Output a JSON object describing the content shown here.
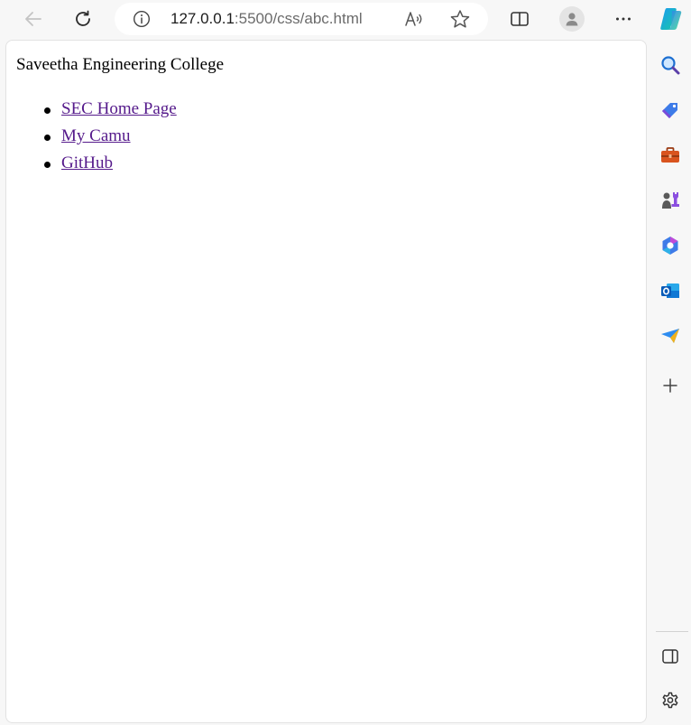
{
  "toolbar": {
    "back_icon": "back-arrow-icon",
    "refresh_icon": "refresh-icon",
    "address": {
      "host": "127.0.0.1",
      "rest": ":5500/css/abc.html",
      "info_icon": "info-icon"
    },
    "read_aloud_icon": "read-aloud-icon",
    "favorite_icon": "star-icon",
    "split_screen_icon": "split-screen-icon",
    "profile_icon": "profile-icon",
    "more_icon": "more-dots-icon",
    "copilot_icon": "copilot-icon"
  },
  "page": {
    "heading": "Saveetha Engineering College",
    "links": [
      {
        "label": "SEC Home Page"
      },
      {
        "label": "My Camu"
      },
      {
        "label": "GitHub"
      }
    ]
  },
  "sidebar": {
    "items": [
      "search-icon",
      "shopping-tag-icon",
      "tools-briefcase-icon",
      "games-icon",
      "microsoft365-icon",
      "outlook-icon",
      "drop-send-icon",
      "add-icon"
    ],
    "bottom": [
      "sidebar-panel-icon",
      "settings-gear-icon"
    ]
  },
  "colors": {
    "visited_link": "#551a8b",
    "chrome_bg": "#f7f7f7",
    "page_bg": "#ffffff"
  }
}
